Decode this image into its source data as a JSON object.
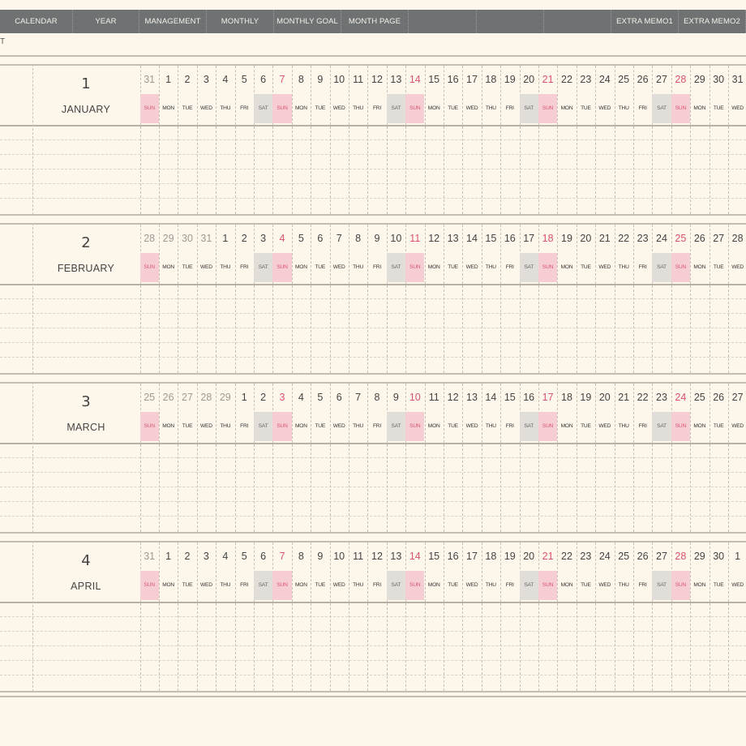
{
  "nav": {
    "tabs": [
      "CALENDAR",
      "YEAR",
      "MANAGEMENT",
      "MONTHLY",
      "MONTHLY GOAL",
      "MONTH PAGE",
      "",
      "",
      "",
      "EXTRA MEMO1",
      "EXTRA MEMO2"
    ]
  },
  "subline": "T",
  "weekdays": [
    "SUN",
    "MON",
    "TUE",
    "WED",
    "THU",
    "FRI",
    "SAT"
  ],
  "months": [
    {
      "number": "1",
      "name": "JANUARY",
      "days": [
        "31",
        "1",
        "2",
        "3",
        "4",
        "5",
        "6",
        "7",
        "8",
        "9",
        "10",
        "11",
        "12",
        "13",
        "14",
        "15",
        "16",
        "17",
        "18",
        "19",
        "20",
        "21",
        "22",
        "23",
        "24",
        "25",
        "26",
        "27",
        "28",
        "29",
        "30",
        "31"
      ],
      "prev_count": 1
    },
    {
      "number": "2",
      "name": "FEBRUARY",
      "days": [
        "28",
        "29",
        "30",
        "31",
        "1",
        "2",
        "3",
        "4",
        "5",
        "6",
        "7",
        "8",
        "9",
        "10",
        "11",
        "12",
        "13",
        "14",
        "15",
        "16",
        "17",
        "18",
        "19",
        "20",
        "21",
        "22",
        "23",
        "24",
        "25",
        "26",
        "27",
        "28"
      ],
      "prev_count": 4
    },
    {
      "number": "3",
      "name": "MARCH",
      "days": [
        "25",
        "26",
        "27",
        "28",
        "29",
        "1",
        "2",
        "3",
        "4",
        "5",
        "6",
        "7",
        "8",
        "9",
        "10",
        "11",
        "12",
        "13",
        "14",
        "15",
        "16",
        "17",
        "18",
        "19",
        "20",
        "21",
        "22",
        "23",
        "24",
        "25",
        "26",
        "27"
      ],
      "prev_count": 5
    },
    {
      "number": "4",
      "name": "APRIL",
      "days": [
        "31",
        "1",
        "2",
        "3",
        "4",
        "5",
        "6",
        "7",
        "8",
        "9",
        "10",
        "11",
        "12",
        "13",
        "14",
        "15",
        "16",
        "17",
        "18",
        "19",
        "20",
        "21",
        "22",
        "23",
        "24",
        "25",
        "26",
        "27",
        "28",
        "29",
        "30",
        "1"
      ],
      "prev_count": 1
    }
  ],
  "colors": {
    "nav_bg": "#6f7272",
    "page_bg": "#fdf6ea",
    "sunday": "#d9546f",
    "sunday_bg": "#f6cdd3",
    "saturday_bg": "#e1deda"
  }
}
